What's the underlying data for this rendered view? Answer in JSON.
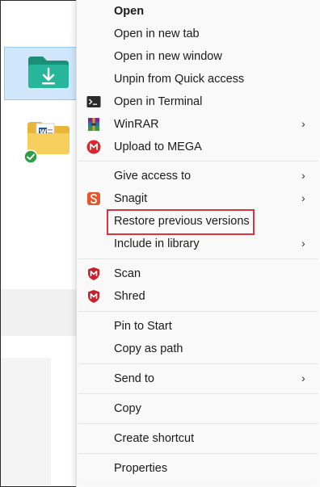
{
  "menu": {
    "items": [
      {
        "label": "Open",
        "icon": null,
        "submenu": false,
        "bold": true
      },
      {
        "label": "Open in new tab",
        "icon": null,
        "submenu": false
      },
      {
        "label": "Open in new window",
        "icon": null,
        "submenu": false
      },
      {
        "label": "Unpin from Quick access",
        "icon": null,
        "submenu": false
      },
      {
        "label": "Open in Terminal",
        "icon": "terminal-icon",
        "submenu": false
      },
      {
        "label": "WinRAR",
        "icon": "winrar-icon",
        "submenu": true
      },
      {
        "label": "Upload to MEGA",
        "icon": "mega-icon",
        "submenu": false
      },
      {
        "label": "Give access to",
        "icon": null,
        "submenu": true
      },
      {
        "label": "Snagit",
        "icon": "snagit-icon",
        "submenu": true
      },
      {
        "label": "Restore previous versions",
        "icon": null,
        "submenu": false,
        "highlighted": true
      },
      {
        "label": "Include in library",
        "icon": null,
        "submenu": true
      },
      {
        "label": "Scan",
        "icon": "mcafee-icon",
        "submenu": false
      },
      {
        "label": "Shred",
        "icon": "mcafee-icon",
        "submenu": false
      },
      {
        "label": "Pin to Start",
        "icon": null,
        "submenu": false
      },
      {
        "label": "Copy as path",
        "icon": null,
        "submenu": false
      },
      {
        "label": "Send to",
        "icon": null,
        "submenu": true
      },
      {
        "label": "Copy",
        "icon": null,
        "submenu": false
      },
      {
        "label": "Create shortcut",
        "icon": null,
        "submenu": false
      },
      {
        "label": "Properties",
        "icon": null,
        "submenu": false
      }
    ],
    "submenu_glyph": "›",
    "highlight_color": "#d9343f"
  },
  "explorer": {
    "selected_folder_icon": "downloads-folder-icon",
    "other_folder_icon": "document-folder-icon",
    "sync_status_icon": "green-check-icon",
    "accent": "#1fa38a"
  }
}
